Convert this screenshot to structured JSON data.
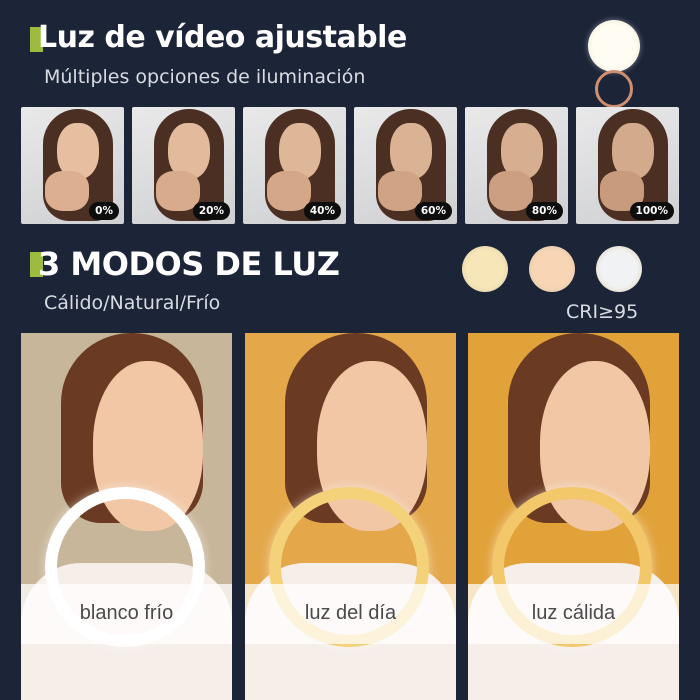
{
  "section1": {
    "title": "Luz de vídeo ajustable",
    "subtitle": "Múltiples opciones de iluminación",
    "brightness_levels": [
      {
        "label": "0%"
      },
      {
        "label": "20%"
      },
      {
        "label": "40%"
      },
      {
        "label": "60%"
      },
      {
        "label": "80%"
      },
      {
        "label": "100%"
      }
    ]
  },
  "section2": {
    "title": "3 MODOS DE LUZ",
    "subtitle": "Cálido/Natural/Frío",
    "cri": "CRI≥95",
    "swatches": [
      {
        "name": "warm-swatch",
        "color": "#f6e6b8"
      },
      {
        "name": "natural-swatch",
        "color": "#f7d5b5"
      },
      {
        "name": "cold-swatch",
        "color": "#f1f2f3"
      }
    ],
    "modes": [
      {
        "label": "blanco frío",
        "bg": "#c8b69a",
        "ring": "#ffffff"
      },
      {
        "label": "luz del día",
        "bg": "#e4a84b",
        "ring": "#f3d27a"
      },
      {
        "label": "luz cálida",
        "bg": "#e2a23a",
        "ring": "#f2c86a"
      }
    ]
  },
  "colors": {
    "background": "#1c2538",
    "accent": "#9dbb3e"
  }
}
